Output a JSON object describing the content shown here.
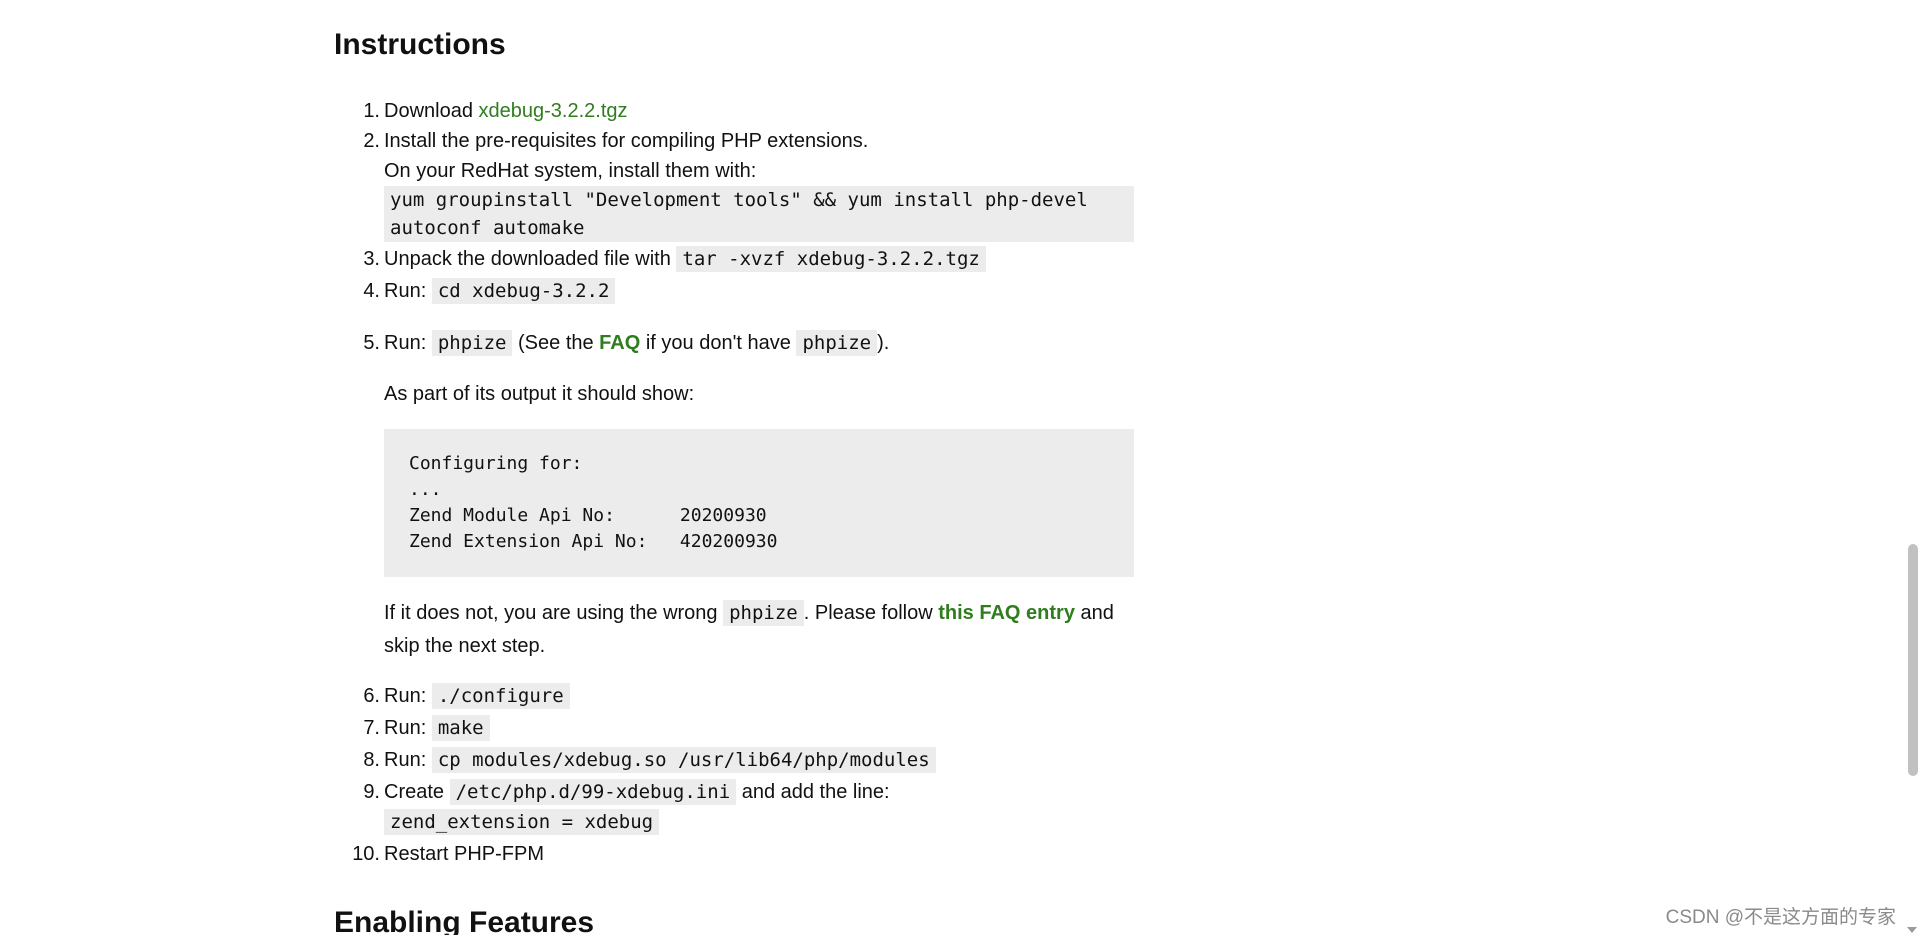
{
  "headings": {
    "instructions": "Instructions",
    "enabling_features": "Enabling Features"
  },
  "steps": {
    "s1": {
      "num": "1.",
      "text": "Download ",
      "link": "xdebug-3.2.2.tgz"
    },
    "s2": {
      "num": "2.",
      "line1": "Install the pre-requisites for compiling PHP extensions.",
      "line2": "On your RedHat system, install them with:",
      "code": "yum groupinstall \"Development tools\" && yum install php-devel autoconf automake"
    },
    "s3": {
      "num": "3.",
      "text": "Unpack the downloaded file with ",
      "code": "tar -xvzf xdebug-3.2.2.tgz"
    },
    "s4": {
      "num": "4.",
      "text": "Run: ",
      "code": "cd xdebug-3.2.2"
    },
    "s5": {
      "num": "5.",
      "run": "Run: ",
      "code": "phpize",
      "see_the": " (See the ",
      "faq_link": "FAQ",
      "if_you_dont": " if you don't have ",
      "code2": "phpize",
      "close": ").",
      "output_intro": "As part of its output it should show:",
      "output_block": "Configuring for:\n...\nZend Module Api No:      20200930\nZend Extension Api No:   420200930",
      "wrong1": "If it does not, you are using the wrong ",
      "wrong_code": "phpize",
      "wrong2": ". Please follow ",
      "faq_entry_link": "this FAQ entry",
      "wrong3": " and skip the next step."
    },
    "s6": {
      "num": "6.",
      "text": "Run: ",
      "code": "./configure"
    },
    "s7": {
      "num": "7.",
      "text": "Run: ",
      "code": "make"
    },
    "s8": {
      "num": "8.",
      "text": "Run: ",
      "code": "cp modules/xdebug.so /usr/lib64/php/modules"
    },
    "s9": {
      "num": "9.",
      "text": "Create ",
      "code": "/etc/php.d/99-xdebug.ini",
      "after": " and add the line:",
      "code2": "zend_extension = xdebug"
    },
    "s10": {
      "num": "10.",
      "text": "Restart PHP-FPM"
    }
  },
  "colors": {
    "link": "#2f7d1e",
    "code_background": "#ececec"
  },
  "watermark": "CSDN @不是这方面的专家"
}
